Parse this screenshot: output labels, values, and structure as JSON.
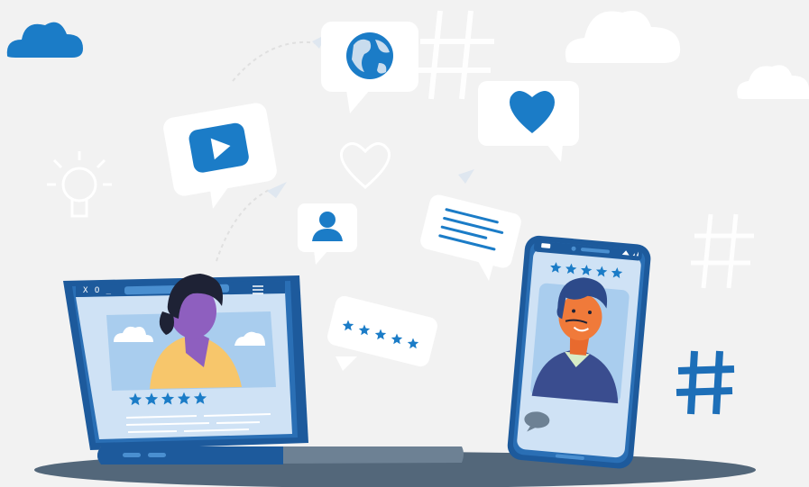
{
  "colors": {
    "background": "#f2f2f2",
    "primary_blue": "#1b7cc7",
    "dark_blue": "#1d5a9c",
    "light_blue": "#a9cdee",
    "screen_blue": "#cfe2f5",
    "shadow": "#53677a",
    "star": "#1b7cc7",
    "hashtag": "#1d6fb8"
  },
  "icons": {
    "cloud": "cloud-icon",
    "globe": "globe-icon",
    "heart": "heart-icon",
    "play": "play-icon",
    "user": "user-icon",
    "hashtag": "hashtag-icon",
    "lightbulb": "lightbulb-icon",
    "star": "star-icon",
    "chat": "chat-icon"
  },
  "laptop": {
    "window_label": "X O _",
    "rating_stars": 5
  },
  "phone": {
    "rating_stars": 5
  },
  "review_bubble": {
    "rating_stars": 5
  }
}
